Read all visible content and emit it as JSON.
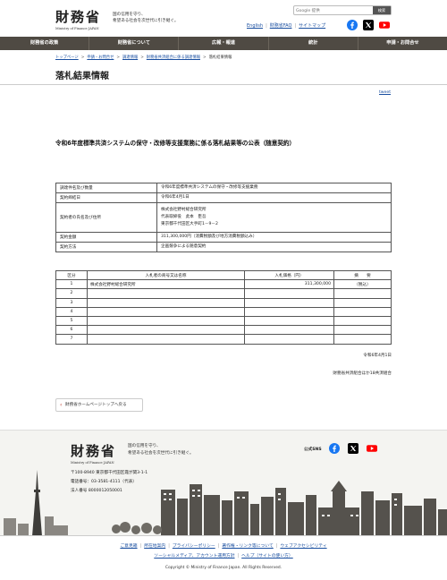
{
  "header": {
    "logo_kanji": "財務省",
    "logo_en": "Ministry of Finance JAPAN",
    "tagline": [
      "国の信用を守り、",
      "希望ある社会を次世代に引き継ぐ。"
    ],
    "search_placeholder": "Google 提供",
    "search_button": "検索",
    "links": [
      "English",
      "財務省FAQ",
      "サイトマップ"
    ]
  },
  "nav": [
    "財務省の政策",
    "財務省について",
    "広報・報道",
    "統計",
    "申請・お問合せ"
  ],
  "breadcrumb": [
    "トップページ",
    "申請・お問合せ",
    "調達情報",
    "財務省共済組合に係る調達情報",
    "落札結果情報"
  ],
  "page_title": "落札結果情報",
  "tweet": "tweet",
  "heading": "令和6年度標準共済システムの保守・改修等支援業務に係る落札結果等の公表（随意契約）",
  "info": {
    "rows": [
      {
        "label": "調達件名及び数量",
        "value": [
          "令和6年度標準共済システムの保守・改修等支援業務"
        ]
      },
      {
        "label": "契約締結日",
        "value": [
          "令和6年4月1日"
        ]
      },
      {
        "label": "契約者の氏名及び住所",
        "value": [
          "株式会社野村総合研究所",
          "代表取締役　此本　臣吾",
          "東京都千代田区大手町1－9－2"
        ]
      },
      {
        "label": "契約金額",
        "value": [
          "311,300,000円（消費税額及び地方消費税額込み）"
        ]
      },
      {
        "label": "契約方法",
        "value": [
          "企画競争による随意契約"
        ]
      }
    ]
  },
  "bids": {
    "headers": [
      "区分",
      "入札者の商号又は名称",
      "入札価格（円）",
      "摘　　要"
    ],
    "rows": [
      {
        "no": "1",
        "name": "株式会社野村総合研究所",
        "price": "311,300,000",
        "note": "（税込）"
      },
      {
        "no": "2",
        "name": "",
        "price": "",
        "note": ""
      },
      {
        "no": "3",
        "name": "",
        "price": "",
        "note": ""
      },
      {
        "no": "4",
        "name": "",
        "price": "",
        "note": ""
      },
      {
        "no": "5",
        "name": "",
        "price": "",
        "note": ""
      },
      {
        "no": "6",
        "name": "",
        "price": "",
        "note": ""
      },
      {
        "no": "7",
        "name": "",
        "price": "",
        "note": ""
      }
    ]
  },
  "date": "令和6年4月1日",
  "org": "財務省共済組合ほか18共済組合",
  "back_button": "財務省ホームページトップへ戻る",
  "footer": {
    "logo_kanji": "財務省",
    "logo_en": "Ministry of Finance JAPAN",
    "tagline": [
      "国の信用を守り、",
      "希望ある社会を次世代に引き継ぐ。"
    ],
    "sns_label": "公式SNS",
    "address": [
      "〒100-8940 東京都千代田区霞が関3-1-1",
      "電話番号：03-3581-4111（代表）",
      "法人番号 8000012050001"
    ],
    "links_row1": [
      "ご意見箱",
      "所在地案内",
      "プライバシーポリシー",
      "著作権・リンク等について",
      "ウェブアクセシビリティ"
    ],
    "links_row2": [
      "ソーシャルメディア、アカウント運用方針",
      "ヘルプ（サイトの使い方）"
    ],
    "copyright": "Copyright © Ministry of Finance Japan. All Rights Reserved."
  },
  "colors": {
    "nav_bg": "#4f4a43",
    "link": "#1a4fa0",
    "facebook": "#1877f2",
    "x": "#000000",
    "youtube": "#ff0000"
  },
  "icons": [
    "facebook-icon",
    "x-icon",
    "youtube-icon"
  ]
}
